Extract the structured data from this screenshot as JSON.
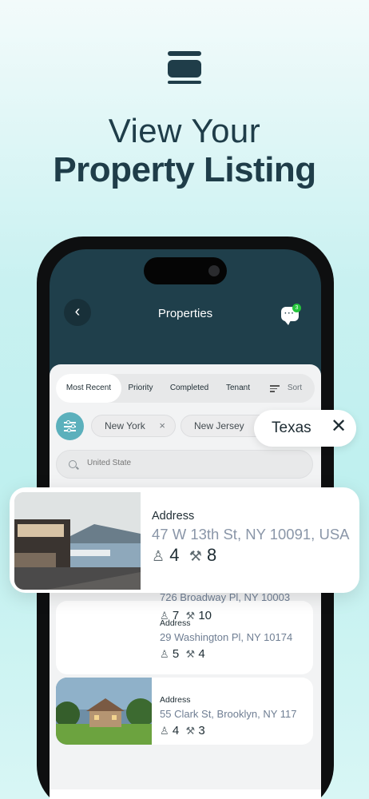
{
  "hero": {
    "line1": "View Your",
    "line2": "Property Listing"
  },
  "header": {
    "title": "Properties",
    "back_icon": "‹",
    "chat_badge": "3"
  },
  "tabs": [
    "Most Recent",
    "Priority",
    "Completed",
    "Tenant",
    "Sort"
  ],
  "chips": [
    {
      "label": "New York",
      "close": "×"
    },
    {
      "label": "New Jersey",
      "close": "×"
    },
    {
      "label": "Texas",
      "close": "✕"
    }
  ],
  "search": {
    "placeholder": "United State"
  },
  "listings": [
    {
      "label": "Address",
      "address": "47 W 13th St, NY 10091, USA",
      "tenants": "4",
      "repairs": "8"
    },
    {
      "label": "Address",
      "address": "726 Broadway Pl, NY 10003",
      "tenants": "7",
      "repairs": "10"
    },
    {
      "label": "Address",
      "address": "29 Washington Pl, NY 10174",
      "tenants": "5",
      "repairs": "4"
    },
    {
      "label": "Address",
      "address": "55 Clark St, Brooklyn, NY 117",
      "tenants": "4",
      "repairs": "3"
    }
  ],
  "icons": {
    "tenant": "person-icon",
    "repair": "tools-icon"
  }
}
